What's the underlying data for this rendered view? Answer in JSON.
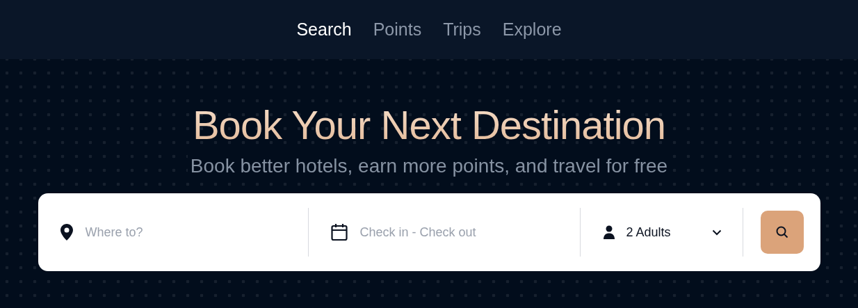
{
  "nav": {
    "tabs": [
      {
        "label": "Search",
        "selected": true
      },
      {
        "label": "Points",
        "selected": false
      },
      {
        "label": "Trips",
        "selected": false
      },
      {
        "label": "Explore",
        "selected": false
      }
    ]
  },
  "hero": {
    "title": "Book Your Next Destination",
    "subtitle": "Book better hotels, earn more points, and travel for free"
  },
  "search_bar": {
    "destination": {
      "placeholder": "Where to?"
    },
    "dates": {
      "placeholder": "Check in - Check out"
    },
    "guests": {
      "value": "2 Adults"
    }
  }
}
